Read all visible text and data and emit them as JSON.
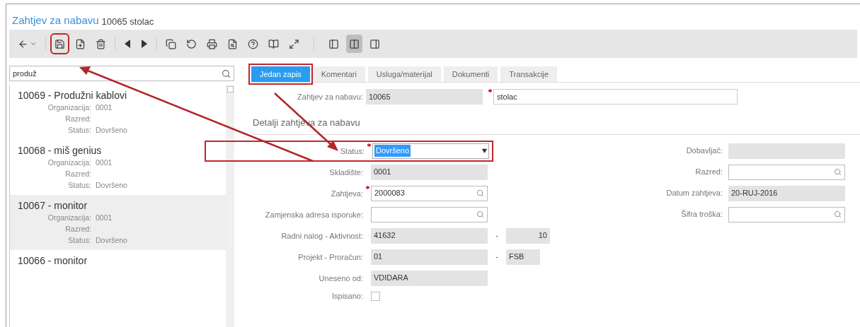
{
  "title": {
    "link": "Zahtjev za nabavu",
    "text": "10065 stolac"
  },
  "toolbar": [
    {
      "kind": "back",
      "annotated": false,
      "selected": false
    },
    {
      "kind": "save",
      "annotated": true,
      "selected": false
    },
    {
      "kind": "new",
      "annotated": false,
      "selected": false
    },
    {
      "kind": "delete",
      "annotated": false,
      "selected": false
    },
    {
      "kind": "prev",
      "annotated": false,
      "selected": false
    },
    {
      "kind": "next",
      "annotated": false,
      "selected": false
    },
    {
      "kind": "copy",
      "annotated": false,
      "selected": false
    },
    {
      "kind": "refresh",
      "annotated": false,
      "selected": false
    },
    {
      "kind": "print",
      "annotated": false,
      "selected": false
    },
    {
      "kind": "preview",
      "annotated": false,
      "selected": false
    },
    {
      "kind": "help",
      "annotated": false,
      "selected": false
    },
    {
      "kind": "book",
      "annotated": false,
      "selected": false
    },
    {
      "kind": "expand",
      "annotated": false,
      "selected": false
    },
    {
      "kind": "paneleft",
      "annotated": false,
      "selected": false
    },
    {
      "kind": "paneboth",
      "annotated": false,
      "selected": true
    },
    {
      "kind": "paneright",
      "annotated": false,
      "selected": false
    }
  ],
  "search": {
    "value": "produž"
  },
  "list": [
    {
      "title": "10069 - Produžni kablovi",
      "selected": false,
      "fields": [
        {
          "label": "Organizacija:",
          "value": "0001"
        },
        {
          "label": "Razred:"
        },
        {
          "label": "Status:",
          "value": "Dovršeno"
        }
      ]
    },
    {
      "title": "10068 - miš genius",
      "selected": false,
      "fields": [
        {
          "label": "Organizacija:",
          "value": "0001"
        },
        {
          "label": "Razred:"
        },
        {
          "label": "Status:",
          "value": "Dovršeno"
        }
      ]
    },
    {
      "title": "10067 - monitor",
      "selected": true,
      "fields": [
        {
          "label": "Organizacija:",
          "value": "0001"
        },
        {
          "label": "Razred:"
        },
        {
          "label": "Status:",
          "value": "Dovršeno"
        }
      ]
    },
    {
      "title": "10066 - monitor",
      "selected": false
    }
  ],
  "tabs": [
    {
      "label": "Jedan zapis",
      "selected": true,
      "annotated": true
    },
    {
      "label": "Komentari",
      "selected": false,
      "annotated": false
    },
    {
      "label": "Usluga/materijal",
      "selected": false,
      "annotated": false
    },
    {
      "label": "Dokumenti",
      "selected": false,
      "annotated": false
    },
    {
      "label": "Transakcije",
      "selected": false,
      "annotated": false
    }
  ],
  "header": {
    "label": "Zahtjev za nabavu:",
    "value": "10065",
    "description": "stolac",
    "required": true
  },
  "section": "Detalji zahtjeva za nabavu",
  "left_fields": [
    {
      "kind": "select",
      "label": "Status:",
      "value": "Dovršeno",
      "required": true,
      "annotated": true
    },
    {
      "kind": "readonly",
      "label": "Skladište:",
      "value": "0001",
      "required": false,
      "annotated": false
    },
    {
      "kind": "lookup",
      "label": "Zahtjeva:",
      "value": "2000083",
      "required": true,
      "annotated": false
    },
    {
      "kind": "lookup",
      "label": "Zamjenska adresa isporuke:",
      "required": false,
      "annotated": false
    },
    {
      "kind": "pair",
      "label": "Radni nalog - Aktivnost:",
      "value": "41632",
      "separator": "-",
      "value2": "10",
      "required": false,
      "annotated": false
    },
    {
      "kind": "pairshort",
      "label": "Projekt - Proračun:",
      "value": "01",
      "separator": "-",
      "value2": "FSB",
      "required": false,
      "annotated": false
    },
    {
      "kind": "readonly",
      "label": "Uneseno od:",
      "value": "VDIDARA",
      "required": false,
      "annotated": false
    },
    {
      "kind": "checkbox",
      "label": "Ispisano:",
      "checked": false,
      "required": false,
      "annotated": false
    }
  ],
  "right_fields": [
    {
      "kind": "readonly",
      "label": "Dobavljač:"
    },
    {
      "kind": "lookup",
      "label": "Razred:"
    },
    {
      "kind": "readonly",
      "label": "Datum zahtjeva:",
      "value": "20-RUJ-2016"
    },
    {
      "kind": "lookup",
      "label": "Šifra troška:"
    }
  ]
}
